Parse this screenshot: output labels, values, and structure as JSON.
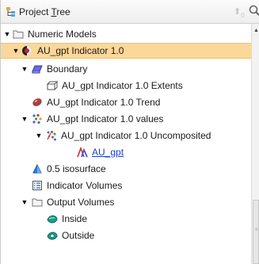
{
  "header": {
    "title_prefix": "Project ",
    "title_underlined": "T",
    "title_suffix": "ree",
    "up_badge": "0"
  },
  "tree": [
    {
      "label": "Numeric Models",
      "icon": "folder-icon"
    },
    {
      "label": "AU_gpt Indicator 1.0",
      "icon": "indicator-model-icon"
    },
    {
      "label": "Boundary",
      "icon": "boundary-icon"
    },
    {
      "label": "AU_gpt Indicator 1.0 Extents",
      "icon": "extents-icon"
    },
    {
      "label": "AU_gpt Indicator 1.0 Trend",
      "icon": "trend-ellipsoid-icon"
    },
    {
      "label": "AU_gpt Indicator 1.0 values",
      "icon": "points-values-icon"
    },
    {
      "label": "AU_gpt Indicator 1.0 Uncomposited",
      "icon": "uncomposited-icon"
    },
    {
      "label": "AU_gpt",
      "icon": "drillhole-icon"
    },
    {
      "label": "0.5 isosurface",
      "icon": "isosurface-icon"
    },
    {
      "label": "Indicator Volumes",
      "icon": "volumes-table-icon"
    },
    {
      "label": "Output Volumes",
      "icon": "folder-icon"
    },
    {
      "label": "Inside",
      "icon": "inside-volume-icon"
    },
    {
      "label": "Outside",
      "icon": "outside-volume-icon"
    }
  ],
  "colors": {
    "selected_row": "#fbd79a",
    "link": "#1a3fd0"
  }
}
